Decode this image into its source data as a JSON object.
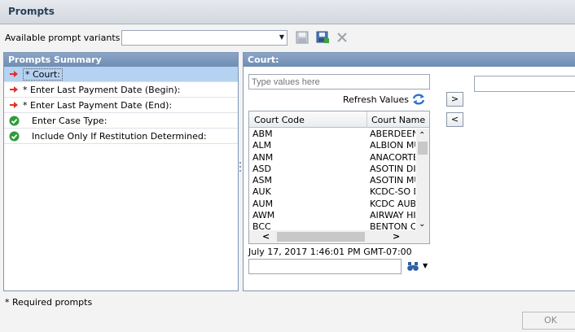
{
  "window": {
    "title": "Prompts"
  },
  "toolbar": {
    "variants_label": "Available prompt variants",
    "variants_value": "",
    "icons": [
      "save-icon",
      "save-as-icon",
      "delete-icon"
    ]
  },
  "summary": {
    "header": "Prompts Summary",
    "items": [
      {
        "label": "* Court:",
        "status": "required-arrow",
        "selected": true
      },
      {
        "label": "* Enter Last Payment Date (Begin):",
        "status": "required-arrow"
      },
      {
        "label": "* Enter Last Payment Date (End):",
        "status": "required-arrow"
      },
      {
        "label": "Enter Case Type:",
        "status": "ok-check"
      },
      {
        "label": "Include Only If Restitution Determined:",
        "status": "ok-check"
      }
    ]
  },
  "detail": {
    "header": "Court:",
    "search_placeholder": "Type values here",
    "refresh_label": "Refresh Values",
    "columns": [
      "Court Code",
      "Court Name"
    ],
    "rows": [
      [
        "ABM",
        "ABERDEEN"
      ],
      [
        "ALM",
        "ALBION MU"
      ],
      [
        "ANM",
        "ANACORTE"
      ],
      [
        "ASD",
        "ASOTIN DI"
      ],
      [
        "ASM",
        "ASOTIN MU"
      ],
      [
        "AUK",
        "KCDC-SO D"
      ],
      [
        "AUM",
        "KCDC AUBU"
      ],
      [
        "AWM",
        "AIRWAY HI"
      ],
      [
        "BCC",
        "BENTON C"
      ]
    ],
    "timestamp": "July 17, 2017 1:46:01 PM GMT-07:00",
    "add_label": ">",
    "remove_label": "<"
  },
  "footer": {
    "required_note": "* Required prompts",
    "ok_label": "OK"
  },
  "colors": {
    "panel_header": "#7f9bbf",
    "selected_row": "#b6d2f2",
    "required_arrow": "#e0302a",
    "ok_check": "#2f9a3a"
  }
}
